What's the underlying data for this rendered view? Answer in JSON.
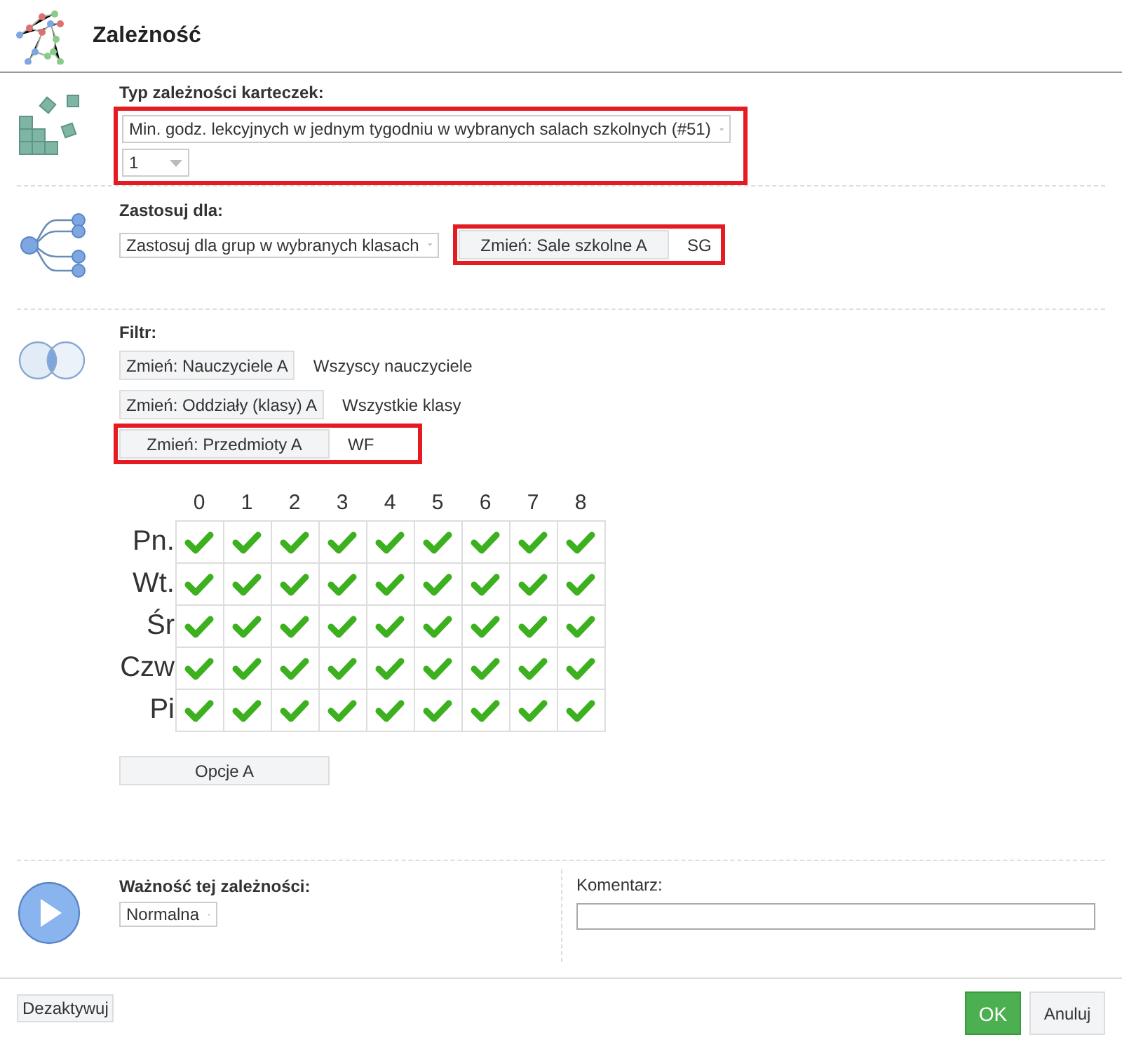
{
  "window": {
    "title": "Zależność"
  },
  "type_section": {
    "label": "Typ zależności karteczek:",
    "highlighted": true,
    "select": {
      "value": "Min. godz. lekcyjnych w jednym tygodniu w wybranych salach szkolnych (#51)"
    },
    "count_select": {
      "value": "1"
    }
  },
  "apply_section": {
    "label": "Zastosuj dla:",
    "select": {
      "value": "Zastosuj dla grup w wybranych klasach"
    },
    "change": {
      "button": "Zmień: Sale szkolne A",
      "value": "SG",
      "highlighted": true
    }
  },
  "filter_section": {
    "label": "Filtr:",
    "filters": [
      {
        "button": "Zmień: Nauczyciele A",
        "value": "Wszyscy nauczyciele",
        "highlighted": false
      },
      {
        "button": "Zmień: Oddziały (klasy) A",
        "value": "Wszystkie klasy",
        "highlighted": false
      },
      {
        "button": "Zmień: Przedmioty A",
        "value": "WF",
        "highlighted": true
      }
    ],
    "grid": {
      "columns": [
        "0",
        "1",
        "2",
        "3",
        "4",
        "5",
        "6",
        "7",
        "8"
      ],
      "rows": [
        {
          "label": "Pn.",
          "cells": [
            {
              "checked": true
            },
            {
              "checked": true
            },
            {
              "checked": true
            },
            {
              "checked": true
            },
            {
              "checked": true
            },
            {
              "checked": true
            },
            {
              "checked": true
            },
            {
              "checked": true
            },
            {
              "checked": true
            }
          ]
        },
        {
          "label": "Wt.",
          "cells": [
            {
              "checked": true
            },
            {
              "checked": true
            },
            {
              "checked": true
            },
            {
              "checked": true
            },
            {
              "checked": true
            },
            {
              "checked": true
            },
            {
              "checked": true
            },
            {
              "checked": true
            },
            {
              "checked": true
            }
          ]
        },
        {
          "label": "Śr",
          "cells": [
            {
              "checked": true
            },
            {
              "checked": true
            },
            {
              "checked": true
            },
            {
              "checked": true
            },
            {
              "checked": true
            },
            {
              "checked": true
            },
            {
              "checked": true
            },
            {
              "checked": true
            },
            {
              "checked": true
            }
          ]
        },
        {
          "label": "Czw",
          "cells": [
            {
              "checked": true
            },
            {
              "checked": true
            },
            {
              "checked": true
            },
            {
              "checked": true
            },
            {
              "checked": true
            },
            {
              "checked": true
            },
            {
              "checked": true
            },
            {
              "checked": true
            },
            {
              "checked": true
            }
          ]
        },
        {
          "label": "Pi",
          "cells": [
            {
              "checked": true
            },
            {
              "checked": true
            },
            {
              "checked": true
            },
            {
              "checked": true
            },
            {
              "checked": true
            },
            {
              "checked": true
            },
            {
              "checked": true
            },
            {
              "checked": true
            },
            {
              "checked": true
            }
          ]
        }
      ]
    },
    "options_button": "Opcje A"
  },
  "importance_section": {
    "label": "Ważność tej zależności:",
    "select": {
      "value": "Normalna"
    },
    "comment_label": "Komentarz:"
  },
  "footer": {
    "deactivate": "Dezaktywuj",
    "ok": "OK",
    "cancel": "Anuluj"
  }
}
